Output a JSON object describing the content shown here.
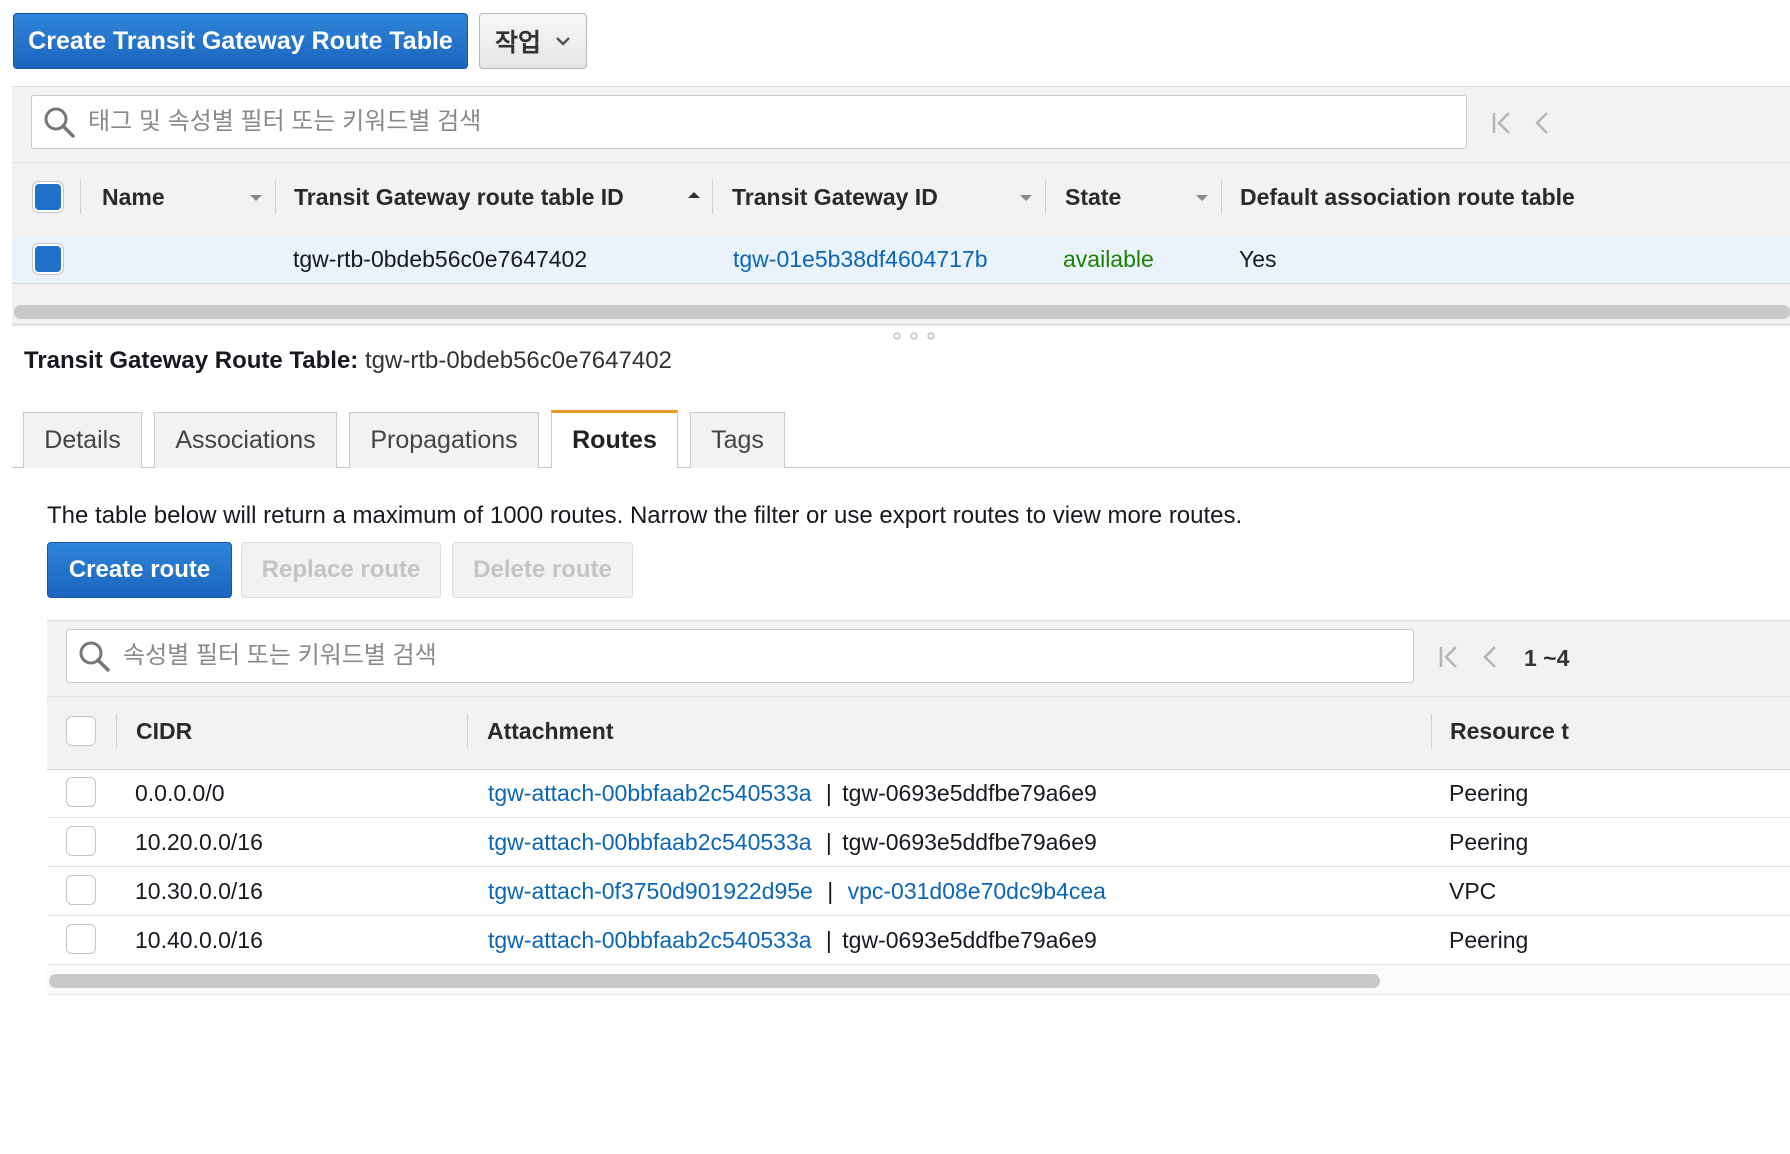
{
  "toolbar": {
    "create_button": "Create Transit Gateway Route Table",
    "actions_button": "작업"
  },
  "top_search": {
    "placeholder": "태그 및 속성별 필터 또는 키워드별 검색"
  },
  "top_table": {
    "columns": [
      "Name",
      "Transit Gateway route table ID",
      "Transit Gateway ID",
      "State",
      "Default association route table"
    ],
    "row": {
      "name": "",
      "route_table_id": "tgw-rtb-0bdeb56c0e7647402",
      "tgw_id": "tgw-01e5b38df4604717b",
      "state": "available",
      "default_association": "Yes"
    }
  },
  "detail": {
    "title_label": "Transit Gateway Route Table:",
    "title_value": "tgw-rtb-0bdeb56c0e7647402",
    "tabs": [
      "Details",
      "Associations",
      "Propagations",
      "Routes",
      "Tags"
    ],
    "active_tab": "Routes",
    "notice": "The table below will return a maximum of 1000 routes. Narrow the filter or use export routes to view more routes.",
    "buttons": {
      "create": "Create route",
      "replace": "Replace route",
      "delete": "Delete route"
    }
  },
  "routes_search": {
    "placeholder": "속성별 필터 또는 키워드별 검색",
    "page_info": "1 ~4"
  },
  "routes_table": {
    "columns": [
      "CIDR",
      "Attachment",
      "Resource t"
    ],
    "rows": [
      {
        "cidr": "0.0.0.0/0",
        "attachment": "tgw-attach-00bbfaab2c540533a",
        "sep": "|",
        "resource": "tgw-0693e5ddfbe79a6e9",
        "type": "Peering"
      },
      {
        "cidr": "10.20.0.0/16",
        "attachment": "tgw-attach-00bbfaab2c540533a",
        "sep": "|",
        "resource": "tgw-0693e5ddfbe79a6e9",
        "type": "Peering"
      },
      {
        "cidr": "10.30.0.0/16",
        "attachment": "tgw-attach-0f3750d901922d95e",
        "sep": "|",
        "resource": "vpc-031d08e70dc9b4cea",
        "type": "VPC"
      },
      {
        "cidr": "10.40.0.0/16",
        "attachment": "tgw-attach-00bbfaab2c540533a",
        "sep": "|",
        "resource": "tgw-0693e5ddfbe79a6e9",
        "type": "Peering"
      }
    ]
  }
}
